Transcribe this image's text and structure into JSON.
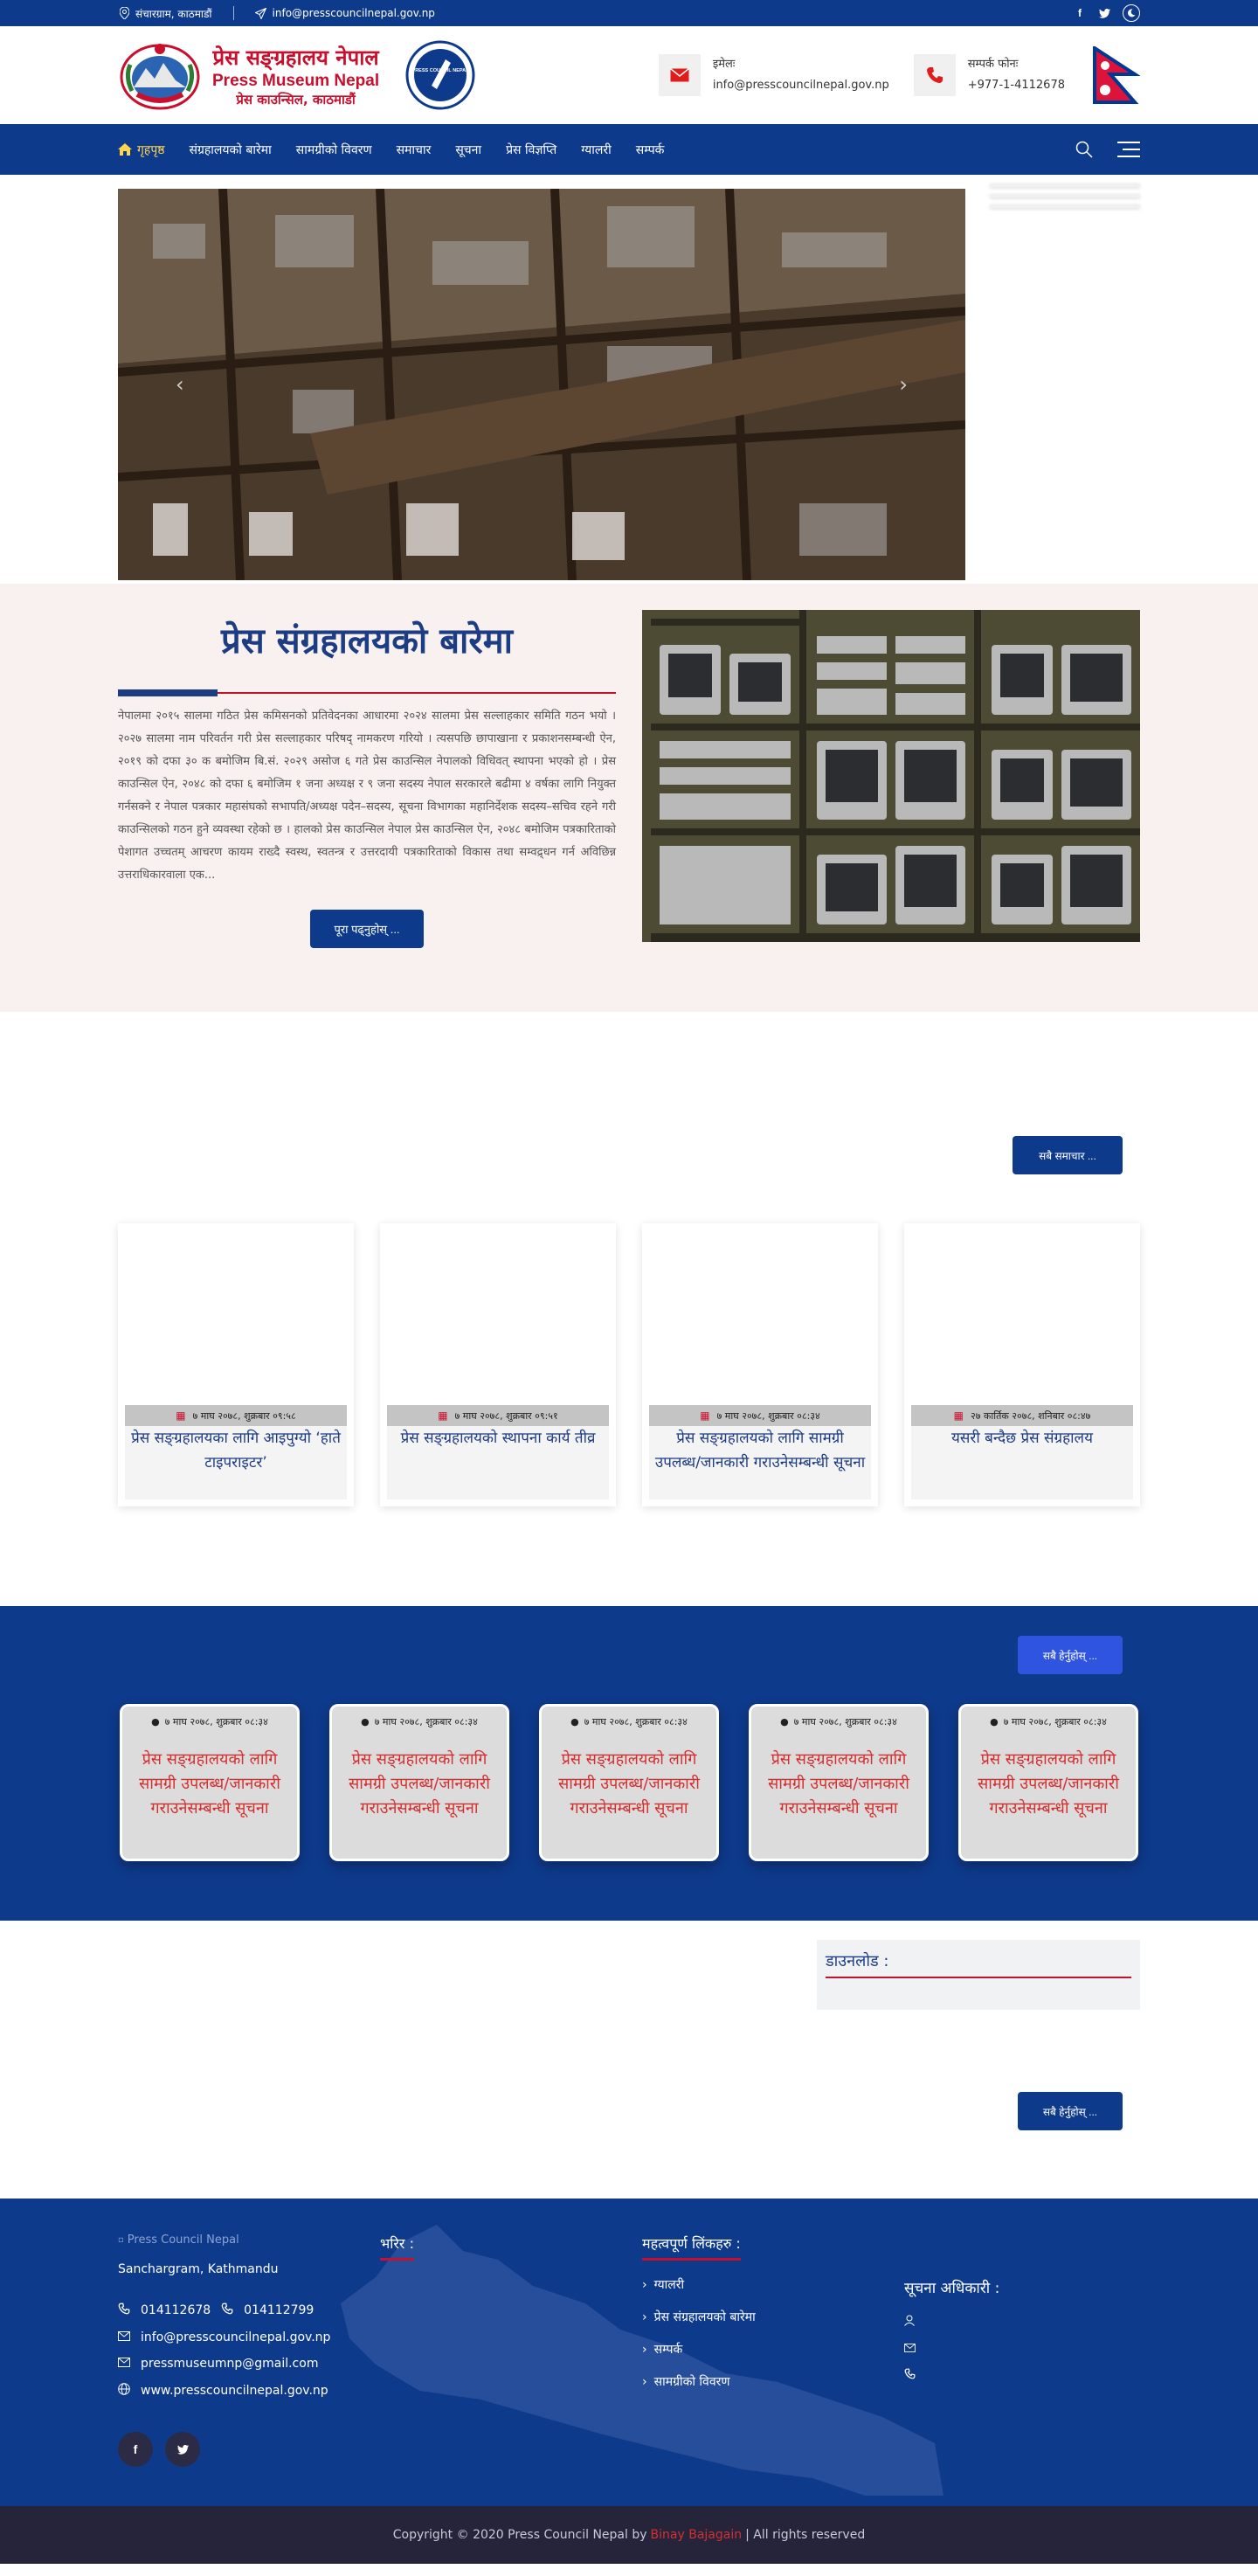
{
  "topbar": {
    "location": "संचारग्राम, काठमाडौं",
    "email": "info@presscouncilnepal.gov.np"
  },
  "header": {
    "brand_np": "प्रेस सङ्ग्रहालय नेपाल",
    "brand_en": "Press Museum Nepal",
    "brand_sub": "प्रेस काउन्सिल, काठमाडौं",
    "pcn_logo_text": "PRESS COUNCIL NEPAL",
    "email_label": "इमेलः",
    "email_value": "info@presscouncilnepal.gov.np",
    "phone_label": "सम्पर्क फोनः",
    "phone_value": "+977-1-4112678"
  },
  "nav": {
    "items": [
      "गृहपृष्ठ",
      "संग्रहालयको बारेमा",
      "सामग्रीको विवरण",
      "समाचार",
      "सूचना",
      "प्रेस विज्ञप्ति",
      "ग्यालरी",
      "सम्पर्क"
    ]
  },
  "about": {
    "title": "प्रेस संग्रहालयको बारेमा",
    "text": "नेपालमा २०१५ सालमा गठित प्रेस कमिसनको प्रतिवेदनका आधारमा २०२४ सालमा प्रेस सल्लाहकार समिति गठन भयो । २०२७ सालमा नाम परिवर्तन गरी प्रेस सल्लाहकार परिषद् नामकरण गरियो । त्यसपछि छापाखाना र प्रकाशनसम्बन्धी ऐन, २०१९ को दफा ३० क बमोजिम बि.सं. २०२९ असोज ६ गते प्रेस काउन्सिल नेपालको विधिवत् स्थापना भएको हो । प्रेस काउन्सिल ऐन, २०४८ को दफा ६ बमोजिम १ जना अध्यक्ष र ९ जना सदस्य नेपाल सरकारले बढीमा ४ वर्षका लागि नियुक्त गर्नसक्ने र नेपाल पत्रकार महासंघको सभापति/अध्यक्ष पदेन–सदस्य, सूचना विभागका महानिर्देशक सदस्य–सचिव रहने गरी काउन्सिलको गठन हुने व्यवस्था रहेको छ । हालको प्रेस काउन्सिल नेपाल प्रेस काउन्सिल ऐन, २०४८ बमोजिम पत्रकारिताको पेशागत उच्चतम् आचरण कायम राख्दै स्वस्थ, स्वतन्त्र र उत्तरदायी पत्रकारिताको विकास तथा सम्वद्र्धन गर्न अविछिन्न उत्तराधिकारवाला एक...",
    "button": "पूरा पढ्नुहोस् ..."
  },
  "news": {
    "all_button": "सबै समाचार ...",
    "items": [
      {
        "date": "७ माघ २०७८, शुक्रबार ०९:५८",
        "title": "प्रेस सङ्ग्रहालयका लागि आइपुग्यो ‘हाते टाइपराइटर’"
      },
      {
        "date": "७ माघ २०७८, शुक्रबार ०९:५१",
        "title": "प्रेस सङ्ग्रहालयको स्थापना कार्य तीव्र"
      },
      {
        "date": "७ माघ २०७८, शुक्रबार ०८:३४",
        "title": "प्रेस सङ्ग्रहालयको लागि सामग्री उपलब्ध/जानकारी गराउनेसम्बन्धी सूचना"
      },
      {
        "date": "२७ कार्तिक २०७८, शनिबार ०८:४७",
        "title": "यसरी बन्दैछ प्रेस संग्रहालय"
      }
    ]
  },
  "notices": {
    "button": "सबै हेर्नुहोस् ...",
    "items": [
      {
        "date": "७ माघ २०७८, शुक्रबार ०८:३४",
        "title": "प्रेस सङ्ग्रहालयको लागि सामग्री उपलब्ध/जानकारी गराउनेसम्बन्धी सूचना"
      },
      {
        "date": "७ माघ २०७८, शुक्रबार ०८:३४",
        "title": "प्रेस सङ्ग्रहालयको लागि सामग्री उपलब्ध/जानकारी गराउनेसम्बन्धी सूचना"
      },
      {
        "date": "७ माघ २०७८, शुक्रबार ०८:३४",
        "title": "प्रेस सङ्ग्रहालयको लागि सामग्री उपलब्ध/जानकारी गराउनेसम्बन्धी सूचना"
      },
      {
        "date": "७ माघ २०७८, शुक्रबार ०८:३४",
        "title": "प्रेस सङ्ग्रहालयको लागि सामग्री उपलब्ध/जानकारी गराउनेसम्बन्धी सूचना"
      },
      {
        "date": "७ माघ २०७८, शुक्रबार ०८:३४",
        "title": "प्रेस सङ्ग्रहालयको लागि सामग्री उपलब्ध/जानकारी गराउनेसम्बन्धी सूचना"
      }
    ]
  },
  "downloads": {
    "heading": "डाउनलोड :",
    "button": "सबै हेर्नुहोस् ..."
  },
  "footer": {
    "logo_alt": "Press Council Nepal",
    "address": "Sanchargram, Kathmandu",
    "phone1": "014112678",
    "phone2": "014112799",
    "email1": "info@presscouncilnepal.gov.np",
    "email2": "pressmuseumnp@gmail.com",
    "website": "www.presscouncilnepal.gov.np",
    "visitor_heading": "भरिर :",
    "links_heading": "महत्वपूर्ण लिंकहरु :",
    "links": [
      "ग्यालरी",
      "प्रेस संग्रहालयको बारेमा",
      "सम्पर्क",
      "सामग्रीको विवरण"
    ],
    "info_officer_heading": "सूचना अधिकारी :",
    "copyright_prefix": "Copyright © 2020 Press Council Nepal by",
    "copyright_author": "Binay Bajagain",
    "copyright_suffix": "| All rights reserved"
  }
}
